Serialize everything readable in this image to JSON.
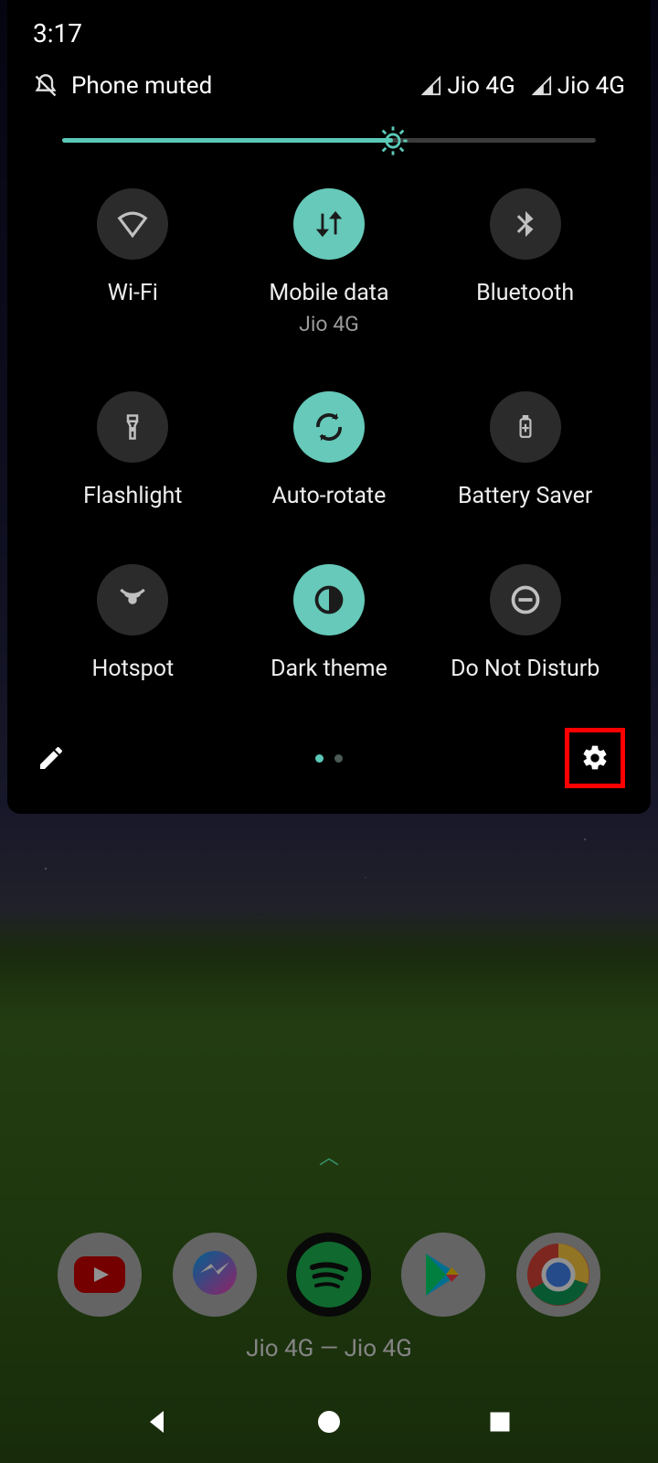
{
  "status": {
    "time": "3:17",
    "muted_text": "Phone muted",
    "signals": [
      "Jio 4G",
      "Jio 4G"
    ]
  },
  "brightness": {
    "percent": 62
  },
  "tiles": [
    {
      "id": "wifi",
      "label": "Wi-Fi",
      "sub": "",
      "on": false,
      "icon": "wifi"
    },
    {
      "id": "mobiledata",
      "label": "Mobile data",
      "sub": "Jio 4G",
      "on": true,
      "icon": "data"
    },
    {
      "id": "bluetooth",
      "label": "Bluetooth",
      "sub": "",
      "on": false,
      "icon": "bluetooth"
    },
    {
      "id": "flashlight",
      "label": "Flashlight",
      "sub": "",
      "on": false,
      "icon": "flashlight"
    },
    {
      "id": "autorotate",
      "label": "Auto-rotate",
      "sub": "",
      "on": true,
      "icon": "rotate"
    },
    {
      "id": "battery",
      "label": "Battery Saver",
      "sub": "",
      "on": false,
      "icon": "battery"
    },
    {
      "id": "hotspot",
      "label": "Hotspot",
      "sub": "",
      "on": false,
      "icon": "hotspot"
    },
    {
      "id": "darktheme",
      "label": "Dark theme",
      "sub": "",
      "on": true,
      "icon": "dark"
    },
    {
      "id": "dnd",
      "label": "Do Not Disturb",
      "sub": "",
      "on": false,
      "icon": "dnd"
    }
  ],
  "pager": {
    "pages": 2,
    "active": 0
  },
  "carrier_footer": "Jio 4G — Jio 4G",
  "dock_apps": [
    "youtube",
    "messenger",
    "spotify",
    "playstore",
    "chrome"
  ],
  "colors": {
    "accent": "#66c9b9",
    "tile_off": "#2b2b2b",
    "highlight": "#ff0000"
  }
}
